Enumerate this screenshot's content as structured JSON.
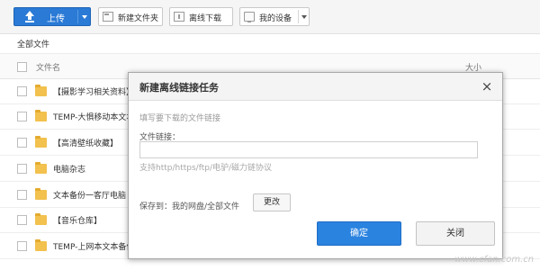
{
  "toolbar": {
    "upload_label": "上传",
    "new_folder_label": "新建文件夹",
    "offline_download_label": "离线下载",
    "my_devices_label": "我的设备"
  },
  "breadcrumb": "全部文件",
  "file_list": {
    "header_name": "文件名",
    "header_size": "大小",
    "rows": [
      {
        "name": "【摄影学习相关资料】"
      },
      {
        "name": "TEMP-大惧移动本文本"
      },
      {
        "name": "【高清壁纸收藏】"
      },
      {
        "name": "电脑杂志"
      },
      {
        "name": "文本备份一客厅电脑"
      },
      {
        "name": "【音乐仓库】"
      },
      {
        "name": "TEMP-上网本文本备份"
      }
    ]
  },
  "dialog": {
    "title": "新建离线链接任务",
    "close_glyph": "×",
    "hint": "填写要下载的文件链接",
    "link_label": "文件链接：",
    "link_value": "",
    "support_text": "支持http/https/ftp/电驴/磁力链协议",
    "save_label": "保存到：",
    "save_path": "我的网盘/全部文件",
    "change_label": "更改",
    "ok_label": "确定",
    "cancel_label": "关闭"
  },
  "watermark": "www.cfan.com.cn",
  "colors": {
    "primary_blue": "#2b83e0",
    "folder_yellow": "#f2c14e"
  },
  "icons": [
    "upload-icon",
    "new-folder-icon",
    "offline-download-icon",
    "device-icon",
    "folder-icon",
    "close-icon"
  ]
}
